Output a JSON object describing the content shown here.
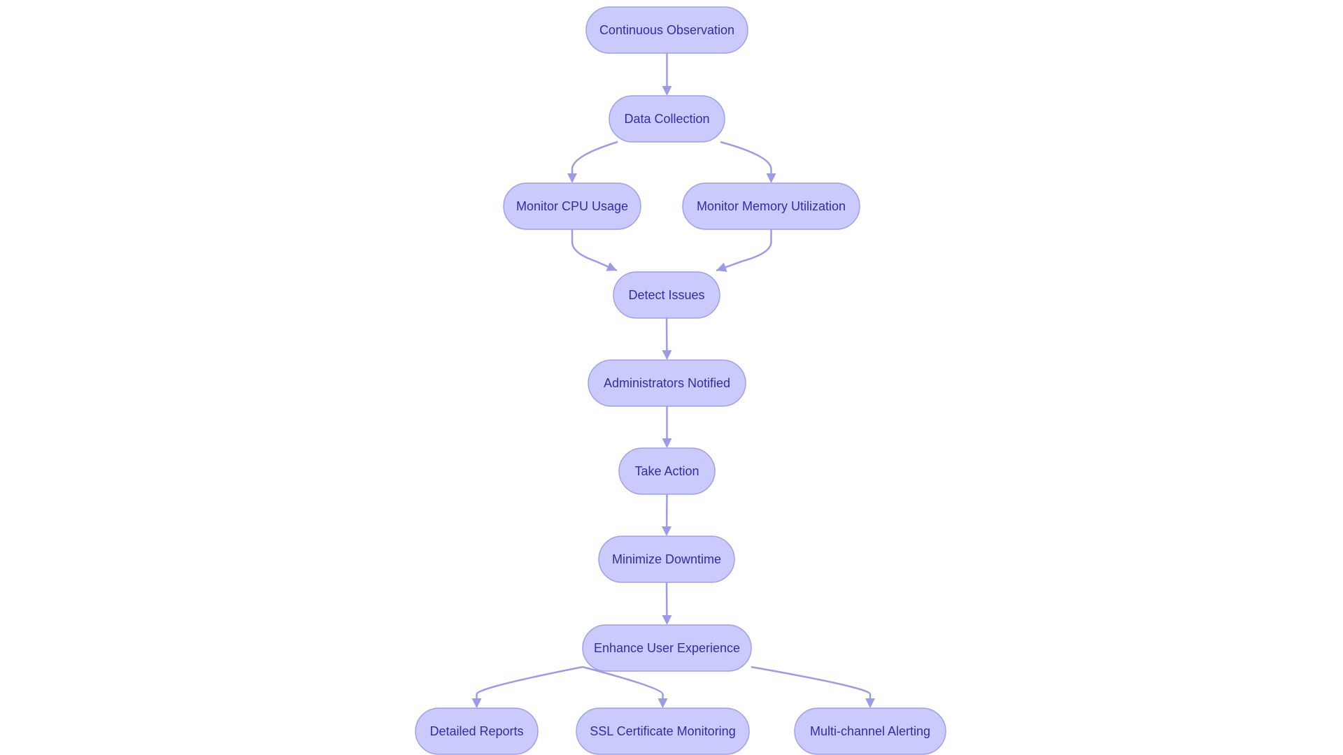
{
  "diagram": {
    "type": "flowchart",
    "direction": "top-down",
    "colors": {
      "node_fill": "#cacafc",
      "node_border": "#a0a0ea",
      "edge": "#9b9be8",
      "text": "#2e2ea8"
    },
    "nodes": [
      {
        "id": "n1",
        "label": "Continuous Observation"
      },
      {
        "id": "n2",
        "label": "Data Collection"
      },
      {
        "id": "n3",
        "label": "Monitor CPU Usage"
      },
      {
        "id": "n4",
        "label": "Monitor Memory Utilization"
      },
      {
        "id": "n5",
        "label": "Detect Issues"
      },
      {
        "id": "n6",
        "label": "Administrators Notified"
      },
      {
        "id": "n7",
        "label": "Take Action"
      },
      {
        "id": "n8",
        "label": "Minimize Downtime"
      },
      {
        "id": "n9",
        "label": "Enhance User Experience"
      },
      {
        "id": "n10",
        "label": "Detailed Reports"
      },
      {
        "id": "n11",
        "label": "SSL Certificate Monitoring"
      },
      {
        "id": "n12",
        "label": "Multi-channel Alerting"
      }
    ],
    "edges": [
      [
        "n1",
        "n2"
      ],
      [
        "n2",
        "n3"
      ],
      [
        "n2",
        "n4"
      ],
      [
        "n3",
        "n5"
      ],
      [
        "n4",
        "n5"
      ],
      [
        "n5",
        "n6"
      ],
      [
        "n6",
        "n7"
      ],
      [
        "n7",
        "n8"
      ],
      [
        "n8",
        "n9"
      ],
      [
        "n9",
        "n10"
      ],
      [
        "n9",
        "n11"
      ],
      [
        "n9",
        "n12"
      ]
    ]
  }
}
